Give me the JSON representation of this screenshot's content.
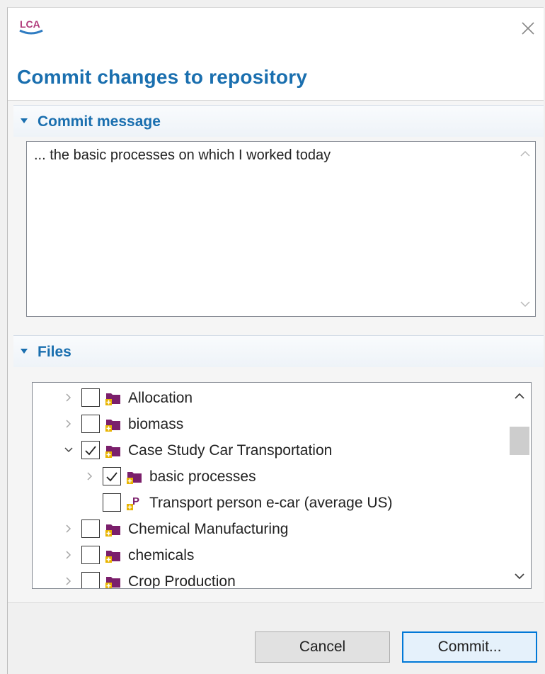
{
  "app": {
    "logo_text": "LCA"
  },
  "dialog": {
    "title": "Commit changes to repository"
  },
  "commit_section": {
    "label": "Commit message",
    "message": "... the basic processes on which I worked today"
  },
  "files_section": {
    "label": "Files",
    "items": [
      {
        "label": "Allocation",
        "level": 0,
        "expander": "collapsed",
        "checked": false,
        "icon": "folder-icon"
      },
      {
        "label": "biomass",
        "level": 0,
        "expander": "collapsed",
        "checked": false,
        "icon": "folder-icon"
      },
      {
        "label": "Case Study Car Transportation",
        "level": 0,
        "expander": "expanded",
        "checked": true,
        "icon": "folder-icon"
      },
      {
        "label": "basic processes",
        "level": 1,
        "expander": "collapsed",
        "checked": true,
        "icon": "folder-icon"
      },
      {
        "label": "Transport person e-car (average US)",
        "level": 1,
        "expander": "none",
        "checked": false,
        "icon": "product-system-icon"
      },
      {
        "label": "Chemical Manufacturing",
        "level": 0,
        "expander": "collapsed",
        "checked": false,
        "icon": "folder-icon"
      },
      {
        "label": "chemicals",
        "level": 0,
        "expander": "collapsed",
        "checked": false,
        "icon": "folder-icon"
      },
      {
        "label": "Crop Production",
        "level": 0,
        "expander": "collapsed",
        "checked": false,
        "icon": "folder-icon"
      }
    ]
  },
  "buttons": {
    "cancel": "Cancel",
    "commit": "Commit..."
  },
  "colors": {
    "accent": "#1a6faf",
    "folder": "#7b1f6b",
    "badge": "#e8b400",
    "focus_border": "#0078d7"
  }
}
